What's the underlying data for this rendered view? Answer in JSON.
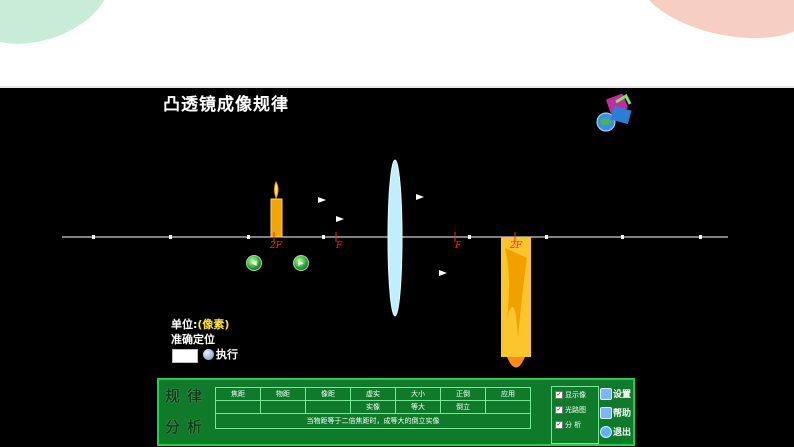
{
  "title": "凸透镜成像规律",
  "labels": {
    "two_f_left": "2F",
    "f_left": "F",
    "f_right": "F",
    "two_f_right": "2F"
  },
  "controls": {
    "unit_label": "单位:",
    "unit_value": "(像素)",
    "precise_position": "准确定位",
    "input_value": "",
    "execute_label": "执行"
  },
  "panel": {
    "tag_chars": [
      "规",
      "律",
      "分",
      "析"
    ],
    "table_headers": [
      "焦距",
      "物距",
      "像距",
      "虚实",
      "大小",
      "正倒",
      "应用"
    ],
    "table_values": [
      "",
      "",
      "",
      "实像",
      "等大",
      "倒立",
      ""
    ],
    "note": "当物距等于二倍焦距时，成等大的倒立实像",
    "checks": [
      {
        "label": "显示像",
        "checked": true
      },
      {
        "label": "光路图",
        "checked": true
      },
      {
        "label": "分  析",
        "checked": true
      }
    ],
    "actions": {
      "settings": "设置",
      "help": "帮助",
      "exit": "退出"
    }
  },
  "colors": {
    "candle_body": "#f2a600",
    "focus_mark": "#ff2222",
    "lens": "#bfeeff",
    "axis": "#ffffff",
    "panel": "#0f7a2a"
  }
}
